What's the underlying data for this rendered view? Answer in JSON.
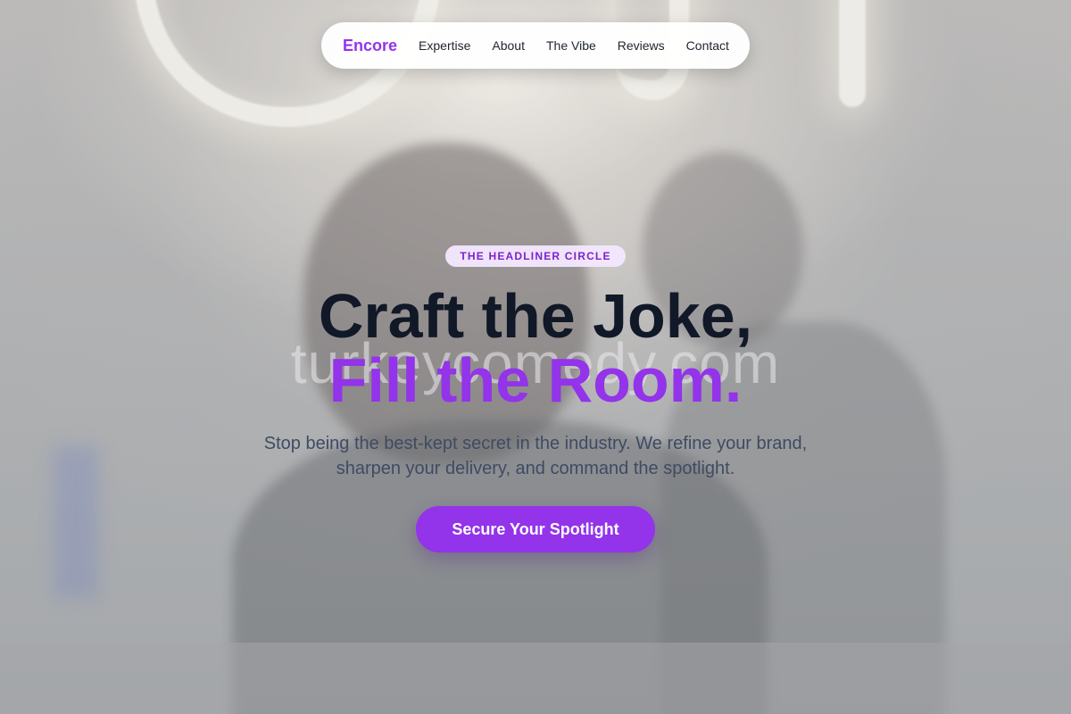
{
  "nav": {
    "brand": "Encore",
    "links": [
      "Expertise",
      "About",
      "The Vibe",
      "Reviews",
      "Contact"
    ]
  },
  "hero": {
    "badge": "THE HEADLINER CIRCLE",
    "headline_line1": "Craft the Joke,",
    "headline_line2": "Fill the Room.",
    "watermark": "turkeycomedy.com",
    "subtext": "Stop being the best-kept secret in the industry. We refine your brand, sharpen your delivery, and command the spotlight.",
    "cta_label": "Secure Your Spotlight"
  },
  "colors": {
    "accent": "#9333ea",
    "heading": "#111827",
    "body_text": "#3f4b63",
    "badge_bg": "#f3e8ff"
  }
}
